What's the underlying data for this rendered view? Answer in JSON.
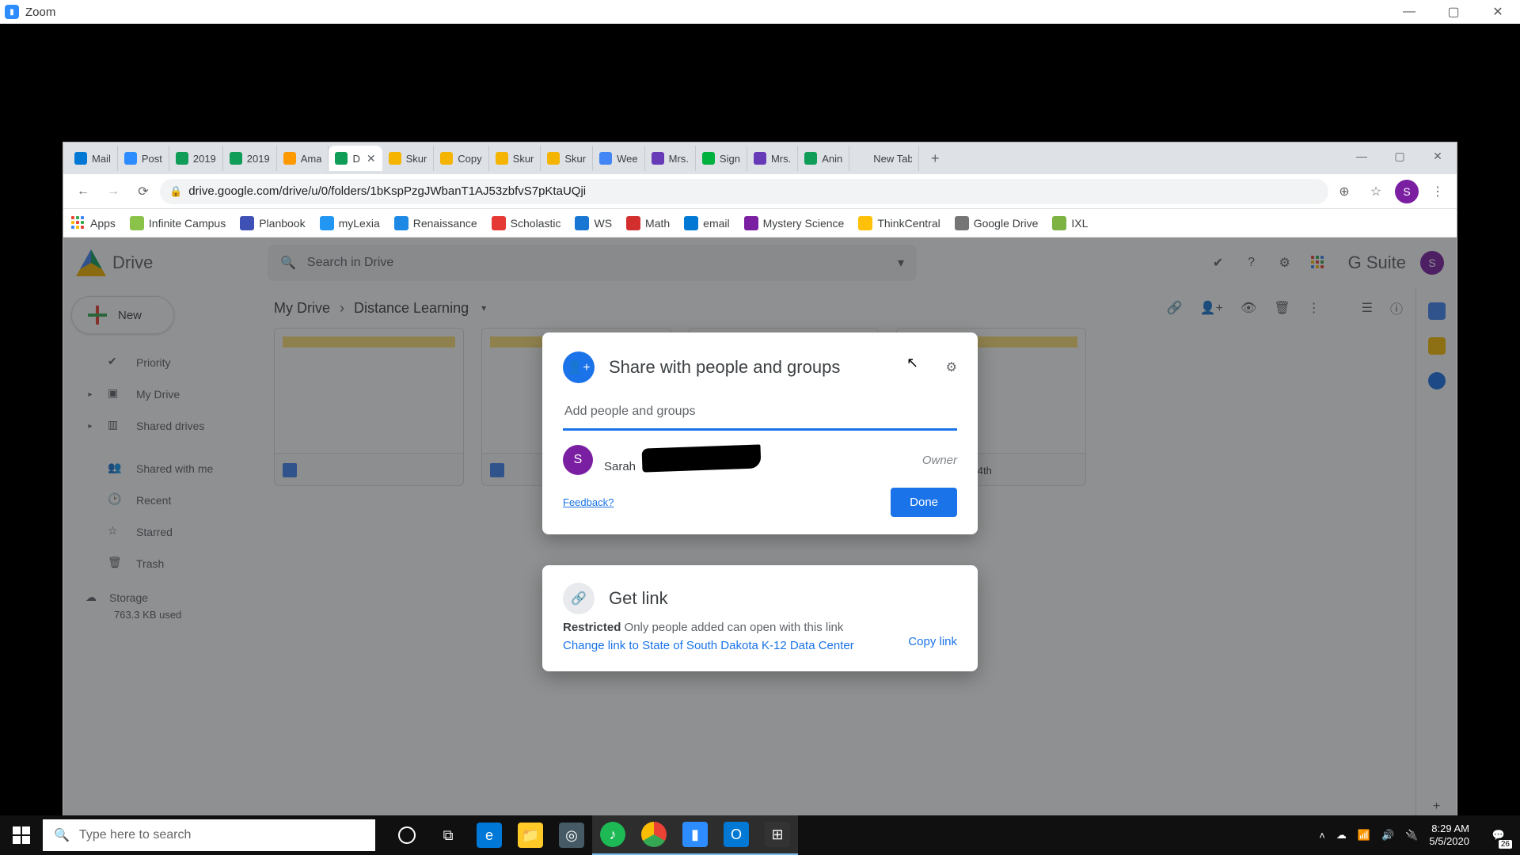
{
  "zoom": {
    "title": "Zoom"
  },
  "tabs": [
    {
      "label": "Mail",
      "fav": "#0078d4"
    },
    {
      "label": "Post",
      "fav": "#2D8CFF"
    },
    {
      "label": "2019",
      "fav": "#0F9D58"
    },
    {
      "label": "2019",
      "fav": "#0F9D58"
    },
    {
      "label": "Ama",
      "fav": "#ff9900"
    },
    {
      "label": "D",
      "fav": "#0F9D58",
      "active": true
    },
    {
      "label": "Skur",
      "fav": "#f4b400"
    },
    {
      "label": "Copy",
      "fav": "#f4b400"
    },
    {
      "label": "Skur",
      "fav": "#f4b400"
    },
    {
      "label": "Skur",
      "fav": "#f4b400"
    },
    {
      "label": "Wee",
      "fav": "#4285f4"
    },
    {
      "label": "Mrs.",
      "fav": "#673ab7"
    },
    {
      "label": "Sign",
      "fav": "#00b140"
    },
    {
      "label": "Mrs.",
      "fav": "#673ab7"
    },
    {
      "label": "Anin",
      "fav": "#0F9D58"
    },
    {
      "label": "New Tab",
      "fav": "transparent"
    }
  ],
  "url": "drive.google.com/drive/u/0/folders/1bKspPzgJWbanT1AJ53zbfvS7pKtaUQji",
  "bookmarks": [
    {
      "label": "Apps",
      "color": "grid"
    },
    {
      "label": "Infinite Campus",
      "color": "#8bc34a"
    },
    {
      "label": "Planbook",
      "color": "#3f51b5"
    },
    {
      "label": "myLexia",
      "color": "#2196f3"
    },
    {
      "label": "Renaissance",
      "color": "#1e88e5"
    },
    {
      "label": "Scholastic",
      "color": "#e53935"
    },
    {
      "label": "WS",
      "color": "#1976d2"
    },
    {
      "label": "Math",
      "color": "#d32f2f"
    },
    {
      "label": "email",
      "color": "#0078d4"
    },
    {
      "label": "Mystery Science",
      "color": "#7b1fa2"
    },
    {
      "label": "ThinkCentral",
      "color": "#ffc107"
    },
    {
      "label": "Google Drive",
      "color": "#757575"
    },
    {
      "label": "IXL",
      "color": "#7cb342"
    }
  ],
  "drive": {
    "brand": "Drive",
    "search_placeholder": "Search in Drive",
    "gsuite": "G Suite",
    "avatar_initial": "S",
    "new_label": "New",
    "nav": {
      "priority": "Priority",
      "mydrive": "My Drive",
      "shareddrives": "Shared drives",
      "sharedwithme": "Shared with me",
      "recent": "Recent",
      "starred": "Starred",
      "trash": "Trash",
      "storage": "Storage",
      "storage_used": "763.3 KB used"
    },
    "breadcrumb": {
      "root": "My Drive",
      "current": "Distance Learning"
    },
    "file_title": "April 21st-24th"
  },
  "share": {
    "title": "Share with people and groups",
    "placeholder": "Add people and groups",
    "person_name": "Sarah",
    "avatar_initial": "S",
    "role": "Owner",
    "feedback": "Feedback?",
    "done": "Done"
  },
  "getlink": {
    "title": "Get link",
    "restricted_label": "Restricted",
    "restricted_desc": " Only people added can open with this link",
    "change": "Change link to State of South Dakota K-12 Data Center",
    "copy": "Copy link"
  },
  "taskbar": {
    "search_placeholder": "Type here to search",
    "time": "8:29 AM",
    "date": "5/5/2020",
    "notif_count": "26"
  }
}
